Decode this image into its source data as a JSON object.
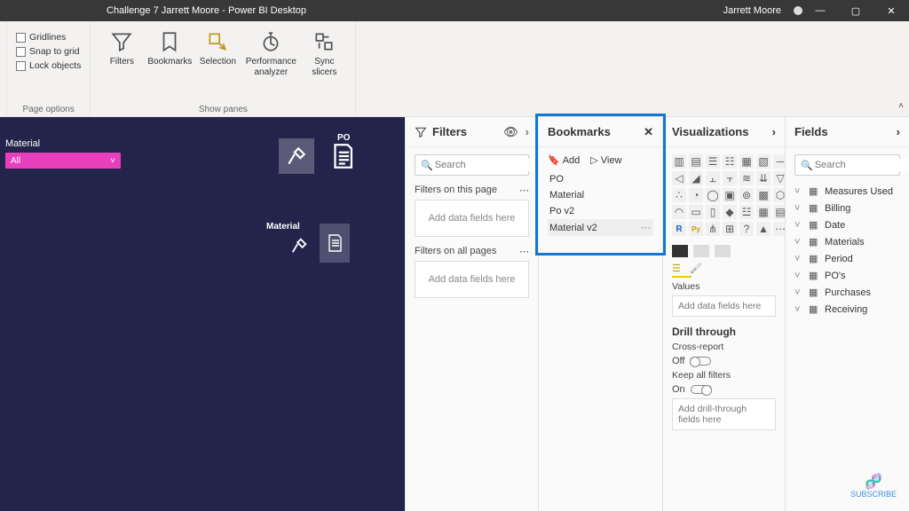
{
  "titlebar": {
    "title": "Challenge 7 Jarrett Moore - Power BI Desktop",
    "user": "Jarrett Moore"
  },
  "ribbon": {
    "page_options": {
      "gridlines": "Gridlines",
      "snap": "Snap to grid",
      "lock": "Lock objects",
      "group_label": "Page options"
    },
    "show_panes": {
      "filters": "Filters",
      "bookmarks": "Bookmarks",
      "selection": "Selection",
      "perf": "Performance analyzer",
      "sync": "Sync slicers",
      "group_label": "Show panes"
    }
  },
  "canvas": {
    "slicer_label": "Material",
    "slicer_value": "All",
    "tile1_label": "PO",
    "tile2_label": "Material"
  },
  "filters": {
    "title": "Filters",
    "search_ph": "Search",
    "sec1": "Filters on this page",
    "sec2": "Filters on all pages",
    "well": "Add data fields here"
  },
  "bookmarks": {
    "title": "Bookmarks",
    "add": "Add",
    "view": "View",
    "items": [
      "PO",
      "Material",
      "Po v2",
      "Material v2"
    ]
  },
  "viz": {
    "title": "Visualizations",
    "values_label": "Values",
    "values_well": "Add data fields here",
    "drill_title": "Drill through",
    "cross_label": "Cross-report",
    "cross_state": "Off",
    "keep_label": "Keep all filters",
    "keep_state": "On",
    "drill_well": "Add drill-through fields here"
  },
  "fields": {
    "title": "Fields",
    "search_ph": "Search",
    "items": [
      "Measures Used",
      "Billing",
      "Date",
      "Materials",
      "Period",
      "PO's",
      "Purchases",
      "Receiving"
    ]
  },
  "subscribe": "SUBSCRIBE"
}
